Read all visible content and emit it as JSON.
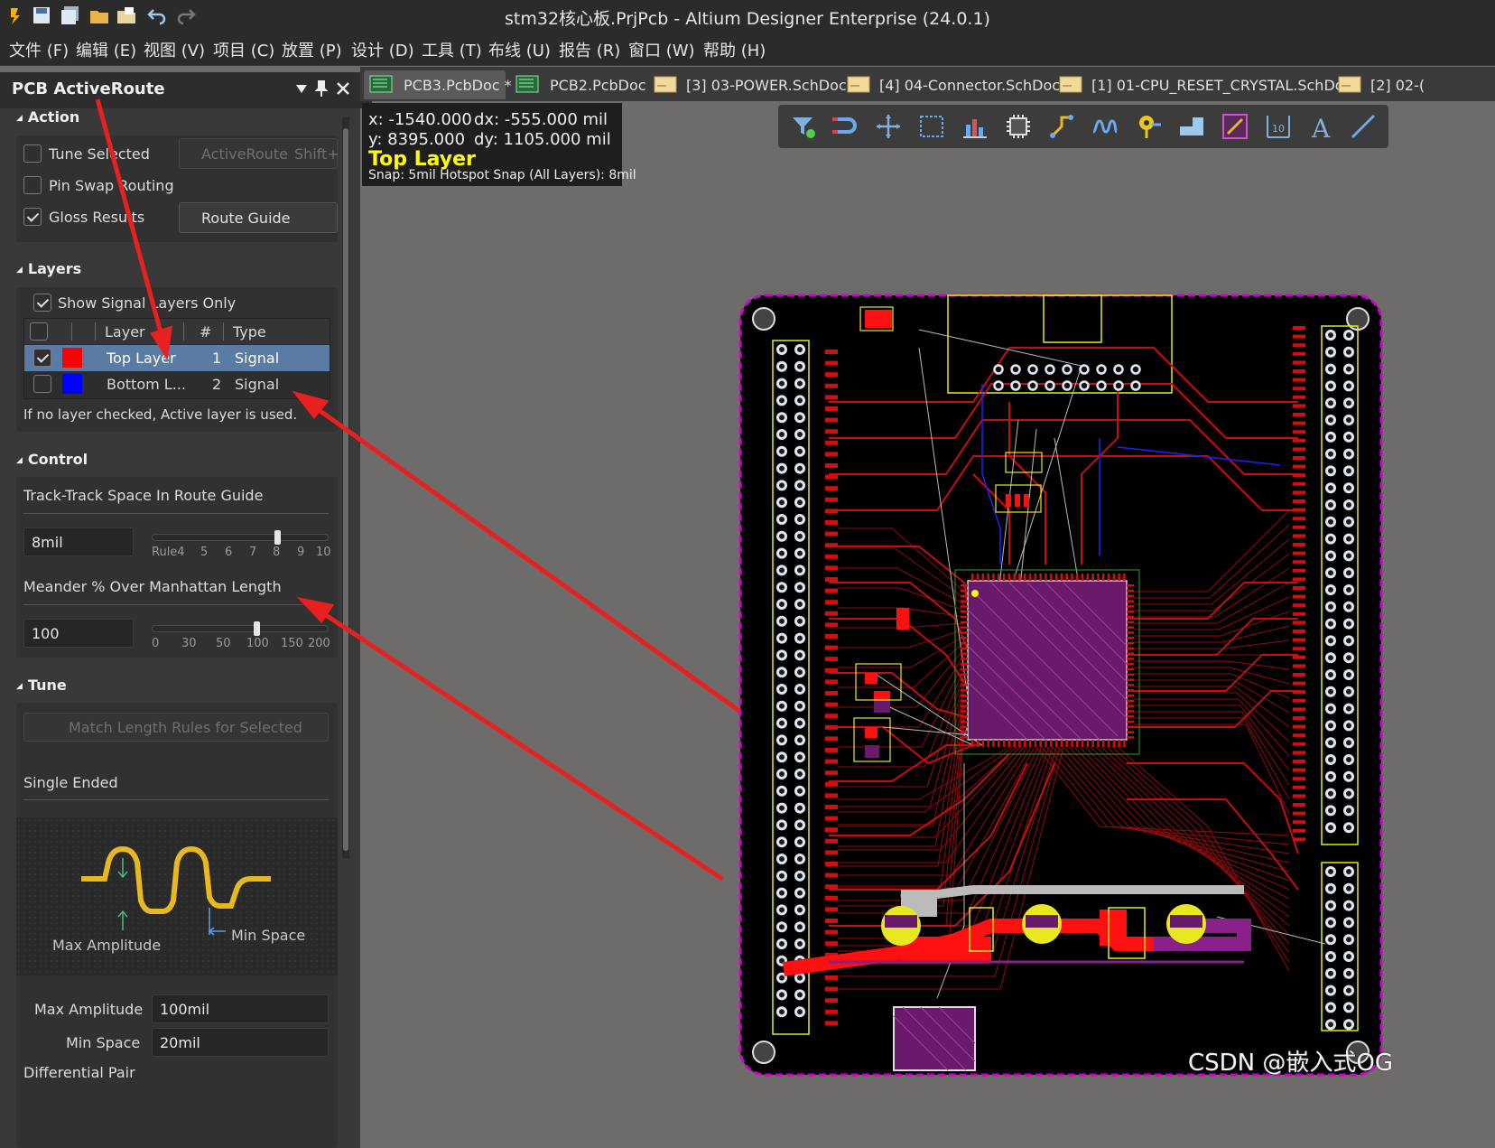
{
  "window": {
    "title": "stm32核心板.PrjPcb - Altium Designer Enterprise (24.0.1)"
  },
  "menu": [
    "文件 (F)",
    "编辑 (E)",
    "视图 (V)",
    "项目 (C)",
    "放置 (P)",
    "设计 (D)",
    "工具 (T)",
    "布线 (U)",
    "报告 (R)",
    "窗口 (W)",
    "帮助 (H)"
  ],
  "panel": {
    "title": "PCB ActiveRoute",
    "action": {
      "header": "Action",
      "tune_selected": "Tune Selected",
      "activeroute_btn": "ActiveRoute",
      "activeroute_shortcut": "Shift+",
      "pin_swap": "Pin Swap Routing",
      "gloss": "Gloss Results",
      "route_guide": "Route Guide"
    },
    "layers": {
      "header": "Layers",
      "show_signal_only": "Show Signal Layers Only",
      "col_layer": "Layer",
      "col_num": "#",
      "col_type": "Type",
      "rows": [
        {
          "name": "Top Layer",
          "num": "1",
          "type": "Signal",
          "color": "#ff0000",
          "checked": true
        },
        {
          "name": "Bottom L...",
          "num": "2",
          "type": "Signal",
          "color": "#0000ff",
          "checked": false
        }
      ],
      "hint": "If no layer checked, Active layer is used."
    },
    "control": {
      "header": "Control",
      "track_label": "Track-Track Space In Route Guide",
      "track_value": "8mil",
      "track_ticks": [
        "Rule4",
        "5",
        "6",
        "7",
        "8",
        "9",
        "10"
      ],
      "track_pos": 0.72,
      "meander_label": "Meander % Over Manhattan Length",
      "meander_value": "100",
      "meander_ticks": [
        "0",
        "30",
        "50",
        "100",
        "150",
        "200"
      ],
      "meander_pos": 0.6
    },
    "tune": {
      "header": "Tune",
      "match_btn": "Match Length Rules for Selected",
      "single_ended": "Single Ended",
      "diag_max_amp": "Max Amplitude",
      "diag_min_space": "Min Space",
      "max_amp_label": "Max Amplitude",
      "max_amp_value": "100mil",
      "min_space_label": "Min Space",
      "min_space_value": "20mil",
      "diff_pair": "Differential Pair"
    }
  },
  "tabs": [
    "PCB3.PcbDoc *",
    "PCB2.PcbDoc",
    "[3] 03-POWER.SchDoc",
    "[4] 04-Connector.SchDoc",
    "[1] 01-CPU_RESET_CRYSTAL.SchDoc",
    "[2] 02-("
  ],
  "coords": {
    "x": "x: -1540.000",
    "dx": "dx:  -555.000 mil",
    "y": "y:  8395.000",
    "dy": "dy:  1105.000 mil",
    "layer": "Top Layer",
    "snap": "Snap: 5mil Hotspot Snap (All Layers): 8mil"
  },
  "toolbar_icons": [
    "filter-icon",
    "interactive-route-icon",
    "cross-probe-icon",
    "select-rect-icon",
    "chart-icon",
    "component-icon",
    "route-icon",
    "diff-pair-icon",
    "via-icon",
    "polygon-icon",
    "track-icon",
    "dimension-icon",
    "text-icon",
    "line-icon"
  ],
  "colors": {
    "top_layer": "#ff0000",
    "bottom_layer": "#0000ff",
    "accent_yellow": "#ffff00",
    "board_outline": "#d000d0"
  },
  "watermark": "CSDN @嵌入式OG"
}
